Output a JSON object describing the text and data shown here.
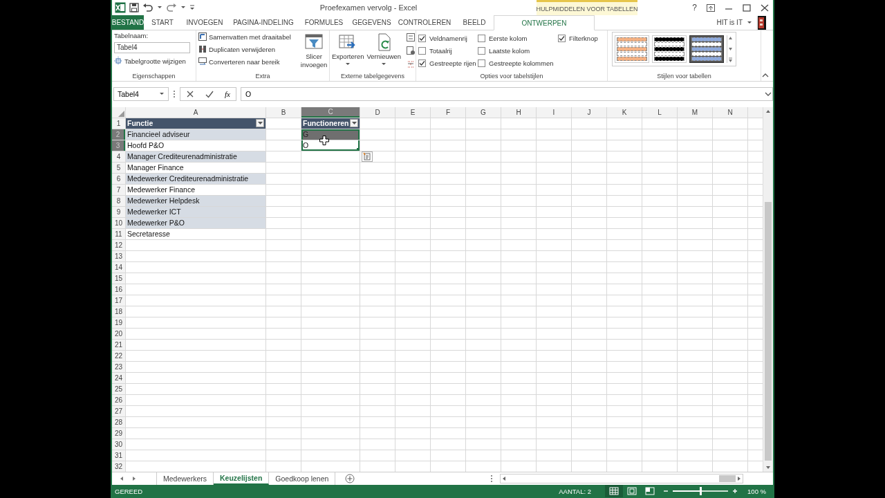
{
  "window": {
    "title": "Proefexamen vervolg - Excel",
    "context_group": "HULPMIDDELEN VOOR TABELLEN",
    "help": "?",
    "user": "HIT is IT"
  },
  "ribbon_tabs": [
    {
      "label": "BESTAND",
      "kind": "file",
      "selected": false
    },
    {
      "label": "START",
      "kind": "tab",
      "selected": false
    },
    {
      "label": "INVOEGEN",
      "kind": "tab",
      "selected": false
    },
    {
      "label": "PAGINA-INDELING",
      "kind": "tab",
      "selected": false
    },
    {
      "label": "FORMULES",
      "kind": "tab",
      "selected": false
    },
    {
      "label": "GEGEVENS",
      "kind": "tab",
      "selected": false
    },
    {
      "label": "CONTROLEREN",
      "kind": "tab",
      "selected": false
    },
    {
      "label": "BEELD",
      "kind": "tab",
      "selected": false
    },
    {
      "label": "ONTWERPEN",
      "kind": "tab",
      "selected": true
    }
  ],
  "ribbon_groups": [
    {
      "label": "Eigenschappen",
      "kind": "properties",
      "field_label": "Tabelnaam:",
      "field_value": "Tabel4",
      "command": "Tabelgrootte wijzigen"
    },
    {
      "label": "Extra",
      "kind": "tools",
      "commands": [
        "Samenvatten met draaitabel",
        "Duplicaten verwijderen",
        "Converteren naar bereik"
      ],
      "large": "Slicer invoegen"
    },
    {
      "label": "Externe tabelgegevens",
      "kind": "external",
      "large": [
        {
          "label": "Exporteren",
          "dropdown": true
        },
        {
          "label": "Vernieuwen",
          "dropdown": true
        }
      ]
    },
    {
      "label": "Opties voor tabelstijlen",
      "kind": "options",
      "checkboxes": [
        {
          "label": "Veldnamenrij",
          "checked": true
        },
        {
          "label": "Totaalrij",
          "checked": false
        },
        {
          "label": "Gestreepte rijen",
          "checked": true
        },
        {
          "label": "Eerste kolom",
          "checked": false
        },
        {
          "label": "Laatste kolom",
          "checked": false
        },
        {
          "label": "Gestreepte kolommen",
          "checked": false
        },
        {
          "label": "Filterknop",
          "checked": true
        }
      ]
    },
    {
      "label": "Stijlen voor tabellen",
      "kind": "styles",
      "styles": [
        {
          "color": "#f4b183",
          "selected": false
        },
        {
          "color": "#000000",
          "selected": false
        },
        {
          "color": "#8ea9db",
          "selected": true
        }
      ]
    }
  ],
  "formula_bar": {
    "name_box": "Tabel4",
    "function_button": "fx",
    "formula": "O"
  },
  "sheet": {
    "columns": [
      {
        "label": "A",
        "selected": false
      },
      {
        "label": "B",
        "selected": false
      },
      {
        "label": "C",
        "selected": true
      },
      {
        "label": "D",
        "selected": false
      },
      {
        "label": "E",
        "selected": false
      },
      {
        "label": "F",
        "selected": false
      },
      {
        "label": "G",
        "selected": false
      },
      {
        "label": "H",
        "selected": false
      },
      {
        "label": "I",
        "selected": false
      },
      {
        "label": "J",
        "selected": false
      },
      {
        "label": "K",
        "selected": false
      },
      {
        "label": "L",
        "selected": false
      },
      {
        "label": "M",
        "selected": false
      },
      {
        "label": "N",
        "selected": false
      }
    ],
    "rows": [
      {
        "label": "1",
        "selected": false,
        "cells": [
          {
            "text": "Functie",
            "kind": "header",
            "filter": true,
            "selected": false
          },
          null,
          {
            "text": "Functioneren",
            "kind": "header",
            "filter": true,
            "selected": false
          }
        ]
      },
      {
        "label": "2",
        "selected": true,
        "cells": [
          {
            "text": "Financieel adviseur",
            "kind": "body",
            "banded": true,
            "selected": false
          },
          null,
          {
            "text": "G",
            "kind": "body",
            "banded": true,
            "selected": true,
            "active": false
          }
        ]
      },
      {
        "label": "3",
        "selected": true,
        "cells": [
          {
            "text": "Hoofd P&O",
            "kind": "body",
            "banded": false,
            "selected": false
          },
          null,
          {
            "text": "O",
            "kind": "body",
            "banded": false,
            "selected": true,
            "active": true
          }
        ]
      },
      {
        "label": "4",
        "selected": false,
        "cells": [
          {
            "text": "Manager Crediteurenadministratie",
            "kind": "body",
            "banded": true,
            "selected": false
          }
        ]
      },
      {
        "label": "5",
        "selected": false,
        "cells": [
          {
            "text": "Manager Finance",
            "kind": "body",
            "banded": false,
            "selected": false
          }
        ]
      },
      {
        "label": "6",
        "selected": false,
        "cells": [
          {
            "text": "Medewerker Crediteurenadministratie",
            "kind": "body",
            "banded": true,
            "selected": false
          }
        ]
      },
      {
        "label": "7",
        "selected": false,
        "cells": [
          {
            "text": "Medewerker Finance",
            "kind": "body",
            "banded": false,
            "selected": false
          }
        ]
      },
      {
        "label": "8",
        "selected": false,
        "cells": [
          {
            "text": "Medewerker Helpdesk",
            "kind": "body",
            "banded": true,
            "selected": false
          }
        ]
      },
      {
        "label": "9",
        "selected": false,
        "cells": [
          {
            "text": "Medewerker ICT",
            "kind": "body",
            "banded": true,
            "selected": false
          }
        ]
      },
      {
        "label": "10",
        "selected": false,
        "cells": [
          {
            "text": "Medewerker P&O",
            "kind": "body",
            "banded": true,
            "selected": false
          }
        ]
      },
      {
        "label": "11",
        "selected": false,
        "cells": [
          {
            "text": "Secretaresse",
            "kind": "body",
            "banded": false,
            "selected": false
          }
        ]
      },
      {
        "label": "12",
        "selected": false
      },
      {
        "label": "13",
        "selected": false
      },
      {
        "label": "14",
        "selected": false
      },
      {
        "label": "15",
        "selected": false
      },
      {
        "label": "16",
        "selected": false
      },
      {
        "label": "17",
        "selected": false
      },
      {
        "label": "18",
        "selected": false
      },
      {
        "label": "19",
        "selected": false
      },
      {
        "label": "20",
        "selected": false
      },
      {
        "label": "21",
        "selected": false
      },
      {
        "label": "22",
        "selected": false
      },
      {
        "label": "23",
        "selected": false
      },
      {
        "label": "24",
        "selected": false
      },
      {
        "label": "25",
        "selected": false
      },
      {
        "label": "26",
        "selected": false
      },
      {
        "label": "27",
        "selected": false
      },
      {
        "label": "28",
        "selected": false
      },
      {
        "label": "29",
        "selected": false
      },
      {
        "label": "30",
        "selected": false
      },
      {
        "label": "31",
        "selected": false
      },
      {
        "label": "32",
        "selected": false
      }
    ]
  },
  "sheet_tabs": [
    {
      "label": "Medewerkers",
      "selected": false
    },
    {
      "label": "Keuzelijsten",
      "selected": true
    },
    {
      "label": "Goedkoop lenen",
      "selected": false
    }
  ],
  "status_bar": {
    "status": "GEREED",
    "count": "AANTAL: 2",
    "views": [
      {
        "selected": true
      },
      {
        "selected": false
      },
      {
        "selected": false
      }
    ],
    "zoom": {
      "level": 0.5,
      "reading": "100 %"
    }
  }
}
